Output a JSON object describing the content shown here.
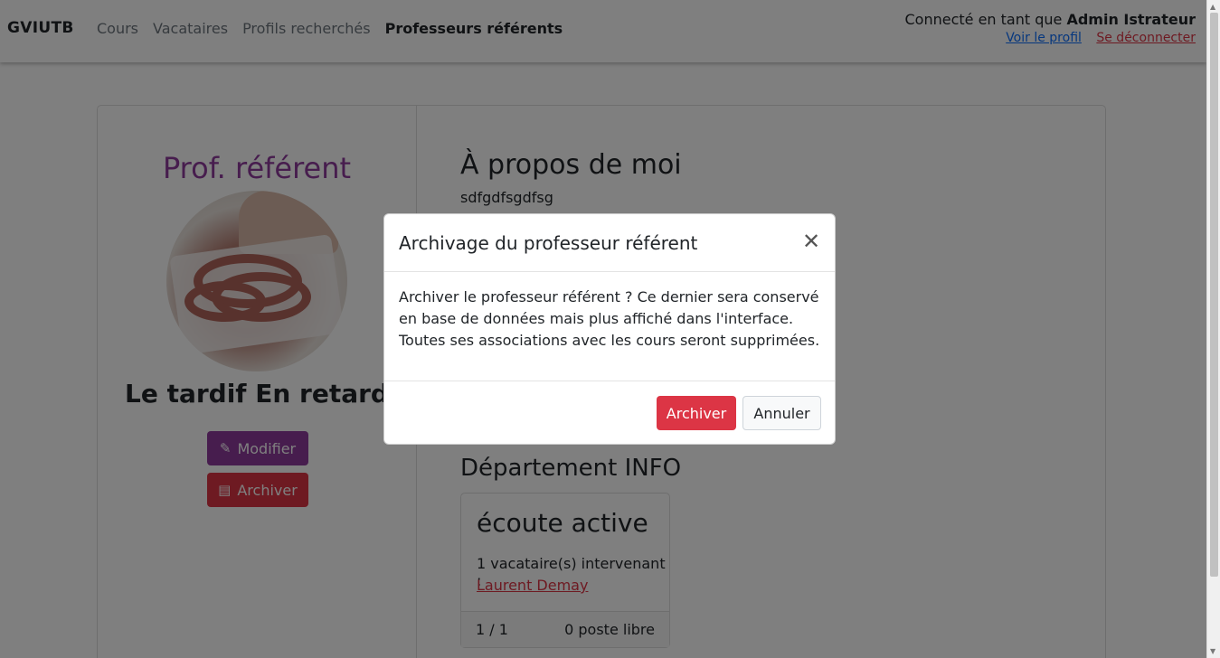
{
  "navbar": {
    "brand": "GVIUTB",
    "links": [
      {
        "label": "Cours"
      },
      {
        "label": "Vacataires"
      },
      {
        "label": "Profils recherchés"
      },
      {
        "label": "Professeurs référents"
      }
    ],
    "user_prefix": "Connecté en tant que",
    "user_name": "Admin Istrateur",
    "profile_link": "Voir le profil",
    "logout_link": "Se déconnecter"
  },
  "profile": {
    "role": "Prof. référent",
    "name": "Le tardif En retard",
    "modify_label": "Modifier",
    "archive_label": "Archiver"
  },
  "about": {
    "title": "À propos de moi",
    "text": "sdfgdfsgdfsg"
  },
  "department": {
    "title": "Département INFO",
    "course": {
      "name": "écoute active",
      "count_label": "1 vacataire(s) intervenant :",
      "vacataire": "Laurent Demay",
      "ratio": "1 / 1",
      "free_slots": "0 poste libre"
    }
  },
  "modal": {
    "title": "Archivage du professeur référent",
    "body": "Archiver le professeur référent ? Ce dernier sera conservé en base de données mais plus affiché dans l'interface. Toutes ses associations avec les cours seront supprimées.",
    "confirm_label": "Archiver",
    "cancel_label": "Annuler"
  },
  "colors": {
    "accent_purple": "#8e3a9c",
    "danger": "#dc3545"
  }
}
